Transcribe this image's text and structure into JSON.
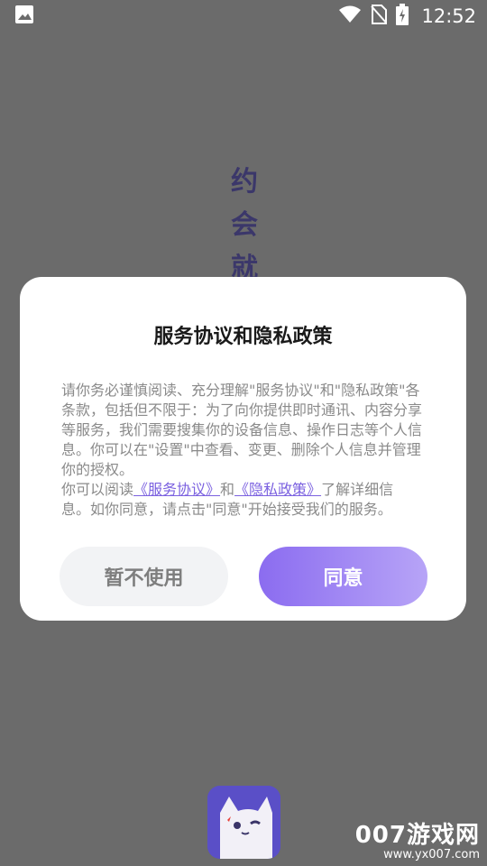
{
  "status_bar": {
    "time": "12:52",
    "icons": [
      "image-icon",
      "wifi-icon",
      "no-sim-icon",
      "battery-charging-icon"
    ]
  },
  "splash": {
    "chars": [
      "约",
      "会",
      "就"
    ]
  },
  "dialog": {
    "title": "服务协议和隐私政策",
    "para1": "请你务必谨慎阅读、充分理解\"服务协议\"和\"隐私政策\"各条款，包括但不限于：为了向你提供即时通讯、内容分享等服务，我们需要搜集你的设备信息、操作日志等个人信息。你可以在\"设置\"中查看、变更、删除个人信息并管理你的授权。",
    "para2_prefix": "你可以阅读",
    "link_service": "《服务协议》",
    "para2_and": "和",
    "link_privacy": "《隐私政策》",
    "para2_suffix": "了解详细信息。如你同意，请点击\"同意\"开始接受我们的服务。",
    "decline_label": "暂不使用",
    "agree_label": "同意"
  },
  "watermark": {
    "main": "007游戏网",
    "url": "www.yx007.com"
  },
  "colors": {
    "overlay": "#6b6b6b",
    "accent": "#8b6cf0",
    "link": "#7b61e0"
  }
}
